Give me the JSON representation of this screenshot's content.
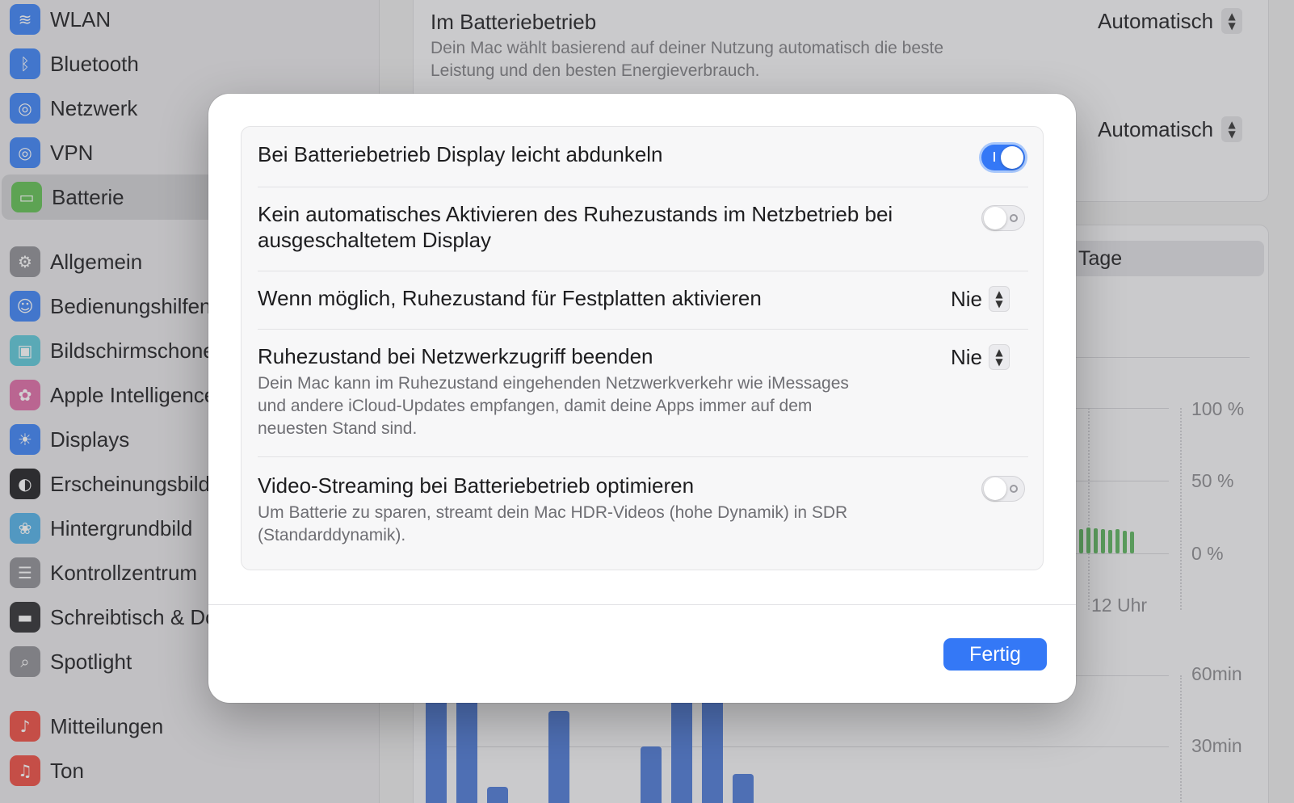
{
  "sidebar": {
    "items": [
      {
        "label": "WLAN",
        "icon": "wifi-icon",
        "color": "#3a82f7",
        "glyph": "≋"
      },
      {
        "label": "Bluetooth",
        "icon": "bluetooth-icon",
        "color": "#3a82f7",
        "glyph": "ᛒ"
      },
      {
        "label": "Netzwerk",
        "icon": "globe-icon",
        "color": "#3a82f7",
        "glyph": "◎"
      },
      {
        "label": "VPN",
        "icon": "vpn-globe-icon",
        "color": "#3a82f7",
        "glyph": "◎"
      },
      {
        "label": "Batterie",
        "icon": "battery-icon",
        "color": "#5fbf4f",
        "glyph": "▭"
      },
      {
        "label": "Allgemein",
        "icon": "gear-icon",
        "color": "#8e8e93",
        "glyph": "⚙"
      },
      {
        "label": "Bedienungshilfen",
        "icon": "accessibility-icon",
        "color": "#3a82f7",
        "glyph": "☺"
      },
      {
        "label": "Bildschirmschoner",
        "icon": "screensaver-icon",
        "color": "#5ac8d8",
        "glyph": "▣"
      },
      {
        "label": "Apple Intelligence",
        "icon": "apple-intelligence-icon",
        "color": "#e06aa6",
        "glyph": "✿"
      },
      {
        "label": "Displays",
        "icon": "sun-icon",
        "color": "#3a82f7",
        "glyph": "☀"
      },
      {
        "label": "Erscheinungsbild",
        "icon": "appearance-icon",
        "color": "#1d1d1f",
        "glyph": "◐"
      },
      {
        "label": "Hintergrundbild",
        "icon": "wallpaper-icon",
        "color": "#4fb0e8",
        "glyph": "❀"
      },
      {
        "label": "Kontrollzentrum",
        "icon": "control-center-icon",
        "color": "#8e8e93",
        "glyph": "☰"
      },
      {
        "label": "Schreibtisch & Dock",
        "icon": "dock-icon",
        "color": "#2c2c2e",
        "glyph": "▬"
      },
      {
        "label": "Spotlight",
        "icon": "magnifier-icon",
        "color": "#8e8e93",
        "glyph": "⌕"
      },
      {
        "label": "Mitteilungen",
        "icon": "bell-icon",
        "color": "#ef4a3f",
        "glyph": "♪"
      },
      {
        "label": "Ton",
        "icon": "speaker-icon",
        "color": "#ef4a3f",
        "glyph": "♫"
      }
    ]
  },
  "background": {
    "battery_mode_title": "Im Batteriebetrieb",
    "battery_mode_desc_1": "Dein Mac wählt basierend auf deiner Nutzung automatisch die beste",
    "battery_mode_desc_2": "Leistung und den besten Energieverbrauch.",
    "battery_mode_value": "Automatisch",
    "second_mode_value": "Automatisch",
    "segment_label": "Tage",
    "chart_y_labels": [
      "100 %",
      "50 %",
      "0 %"
    ],
    "chart_x_label": "12 Uhr",
    "usage_y_labels": [
      "60min",
      "30min"
    ]
  },
  "dialog": {
    "rows": [
      {
        "title": "Bei Batteriebetrieb Display leicht abdunkeln",
        "toggle_on": true
      },
      {
        "title_1": "Kein automatisches Aktivieren des Ruhezustands im Netzbetrieb bei",
        "title_2": "ausgeschaltetem Display",
        "toggle_on": false
      },
      {
        "title": "Wenn möglich, Ruhezustand für Festplatten aktivieren",
        "value": "Nie"
      },
      {
        "title": "Ruhezustand bei Netzwerkzugriff beenden",
        "value": "Nie",
        "desc_1": "Dein Mac kann im Ruhezustand eingehenden Netzwerkverkehr wie iMessages",
        "desc_2": "und andere iCloud-Updates empfangen, damit deine Apps immer auf dem",
        "desc_3": "neuesten Stand sind."
      },
      {
        "title": "Video-Streaming bei Batteriebetrieb optimieren",
        "toggle_on": false,
        "desc_1": "Um Batterie zu sparen, streamt dein Mac HDR-Videos (hohe Dynamik) in SDR",
        "desc_2": "(Standarddynamik)."
      }
    ],
    "done_label": "Fertig"
  },
  "colors": {
    "accent": "#3478f6",
    "battery_green": "#5ab55c",
    "usage_blue": "#4a78d6"
  }
}
